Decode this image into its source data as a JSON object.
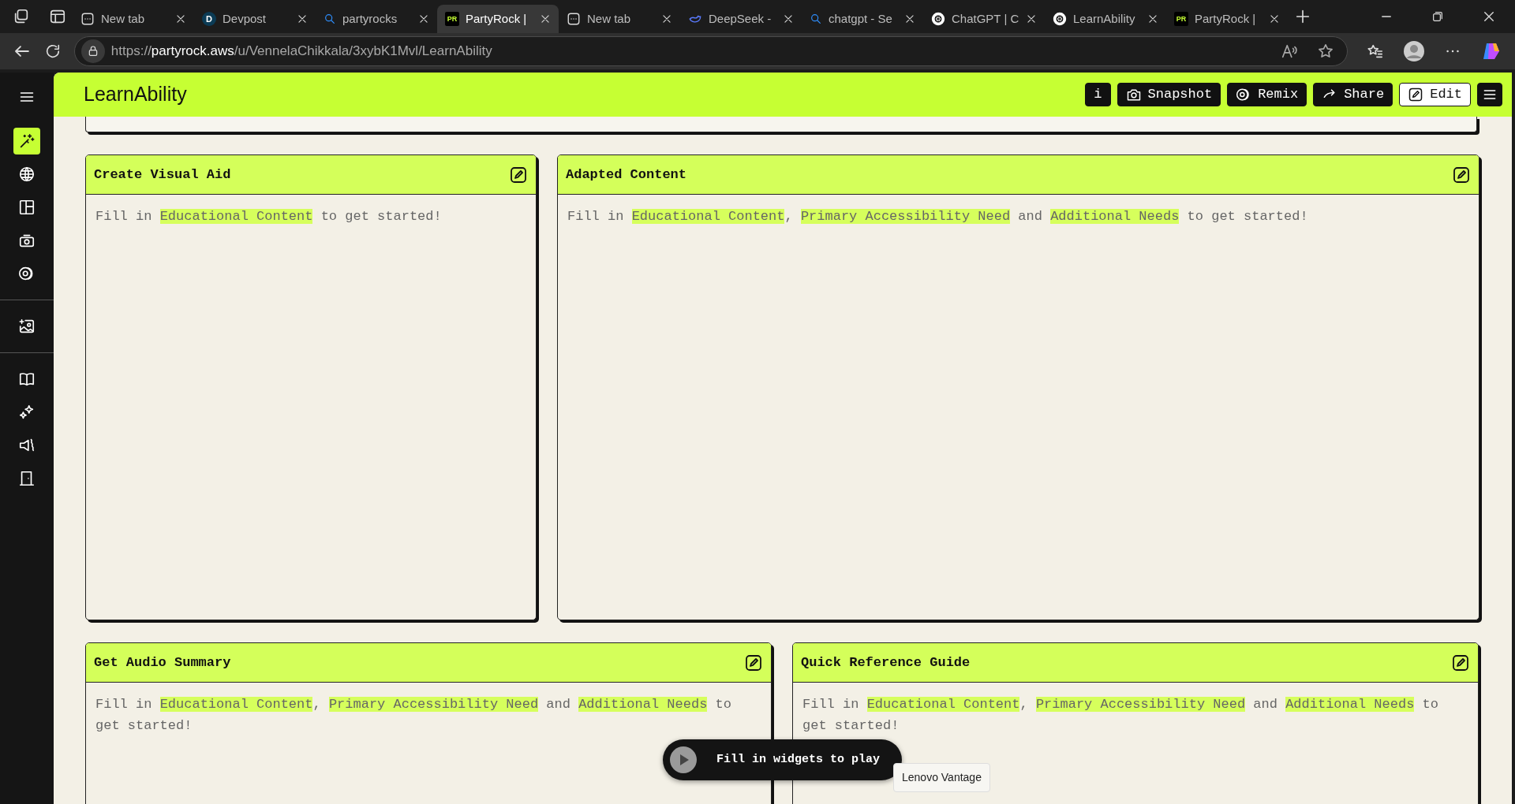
{
  "browser": {
    "tabs": [
      {
        "label": "New tab",
        "kind": "window",
        "selected": false
      },
      {
        "label": "Devpost",
        "kind": "letter",
        "mark": "D",
        "selected": false
      },
      {
        "label": "partyrocks",
        "kind": "search",
        "selected": false
      },
      {
        "label": "PartyRock |",
        "kind": "letter",
        "mark": "PR",
        "selected": true
      },
      {
        "label": "New tab",
        "kind": "window",
        "selected": false
      },
      {
        "label": "DeepSeek -",
        "kind": "whale",
        "selected": false
      },
      {
        "label": "chatgpt - Se",
        "kind": "search",
        "selected": false
      },
      {
        "label": "ChatGPT | C",
        "kind": "swirl",
        "selected": false
      },
      {
        "label": "LearnAbility",
        "kind": "swirl",
        "selected": false
      },
      {
        "label": "PartyRock |",
        "kind": "letter",
        "mark": "PR",
        "selected": false
      }
    ],
    "url_prefix": "https://",
    "url_host": "partyrock.aws",
    "url_path": "/u/VennelaChikkala/3xybK1Mvl/LearnAbility"
  },
  "sidebar": {
    "groups": [
      [
        {
          "kind": "wand",
          "selected": true
        },
        {
          "kind": "globe",
          "selected": false
        },
        {
          "kind": "layout",
          "selected": false
        },
        {
          "kind": "camera",
          "selected": false
        },
        {
          "kind": "remix",
          "selected": false
        }
      ],
      [
        {
          "kind": "image",
          "selected": false
        }
      ],
      [
        {
          "kind": "book",
          "selected": false
        },
        {
          "kind": "sparkle",
          "selected": false
        },
        {
          "kind": "megaphone",
          "selected": false
        },
        {
          "kind": "door",
          "selected": false
        }
      ]
    ]
  },
  "app": {
    "title": "LearnAbility",
    "buttons": [
      {
        "label": "i",
        "kind": "info"
      },
      {
        "label": "Snapshot",
        "kind": "camera"
      },
      {
        "label": "Remix",
        "kind": "remix"
      },
      {
        "label": "Share",
        "kind": "share"
      },
      {
        "label": "Edit",
        "kind": "edit"
      },
      {
        "kind": "menu"
      }
    ]
  },
  "widgets": [
    [
      {
        "title": "Create Visual Aid",
        "prompt": [
          {
            "text": "Fill in ",
            "highlight": false
          },
          {
            "text": "Educational Content",
            "highlight": true
          },
          {
            "text": " to get started!",
            "highlight": false
          }
        ]
      },
      {
        "title": "Adapted Content",
        "prompt": [
          {
            "text": "Fill in ",
            "highlight": false
          },
          {
            "text": "Educational Content",
            "highlight": true
          },
          {
            "text": ", ",
            "highlight": false
          },
          {
            "text": "Primary Accessibility Need",
            "highlight": true
          },
          {
            "text": " and ",
            "highlight": false
          },
          {
            "text": "Additional Needs",
            "highlight": true
          },
          {
            "text": " to get started!",
            "highlight": false
          }
        ]
      }
    ],
    [
      {
        "title": "Get Audio Summary",
        "prompt": [
          {
            "text": "Fill in ",
            "highlight": false
          },
          {
            "text": "Educational Content",
            "highlight": true
          },
          {
            "text": ", ",
            "highlight": false
          },
          {
            "text": "Primary Accessibility Need",
            "highlight": true
          },
          {
            "text": " and ",
            "highlight": false
          },
          {
            "text": "Additional Needs",
            "highlight": true
          },
          {
            "text": " to get started!",
            "highlight": false
          }
        ]
      },
      {
        "title": "Quick Reference Guide",
        "prompt": [
          {
            "text": "Fill in ",
            "highlight": false
          },
          {
            "text": "Educational Content",
            "highlight": true
          },
          {
            "text": ", ",
            "highlight": false
          },
          {
            "text": "Primary Accessibility Need",
            "highlight": true
          },
          {
            "text": " and ",
            "highlight": false
          },
          {
            "text": "Additional Needs",
            "highlight": true
          },
          {
            "text": " to get started!",
            "highlight": false
          }
        ]
      }
    ]
  ],
  "player": {
    "label": "Fill in widgets to play"
  },
  "tooltip": "Lenovo Vantage"
}
